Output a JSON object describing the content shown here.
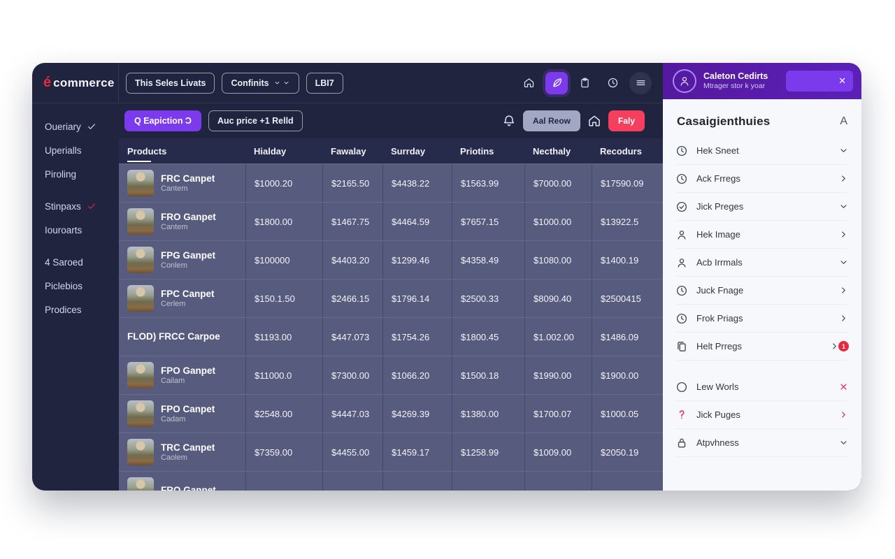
{
  "brand": {
    "mark": "é",
    "name": "commerce"
  },
  "colors": {
    "accent_purple": "#7c3aed",
    "accent_red": "#f43f5e",
    "brand_red": "#e8283f",
    "window_bg": "#20243e",
    "row_bg": "#575b7d",
    "panel_header_purple": "#5b21b6"
  },
  "header": {
    "btn_sales": "This Seles Livats",
    "btn_configs": "Confinits",
    "btn_code": "LBI7",
    "icons": [
      "home",
      "feather",
      "clipboard",
      "clock",
      "menu"
    ],
    "active_icon": "feather"
  },
  "toolbar": {
    "btn_expect": "Q Eapiction Ɔ",
    "btn_price": "Auc price +1 Relld",
    "bell_icon": "bell",
    "btn_review": "Aal Reow",
    "home_icon": "home",
    "btn_faly": "Faly"
  },
  "sidebar": {
    "items": [
      {
        "label": "Oueriary",
        "check": "white",
        "gap": false
      },
      {
        "label": "Uperialls",
        "check": null,
        "gap": false
      },
      {
        "label": "Piroling",
        "check": null,
        "gap": false
      },
      {
        "label": "Stinpaxs",
        "check": "red",
        "gap": true
      },
      {
        "label": "Iouroarts",
        "check": null,
        "gap": false
      },
      {
        "label": "4 Saroed",
        "check": null,
        "gap": true
      },
      {
        "label": "Piclebios",
        "check": null,
        "gap": false
      },
      {
        "label": "Prodices",
        "check": null,
        "gap": false
      }
    ]
  },
  "table": {
    "columns": [
      "Products",
      "Hialday",
      "Fawalay",
      "Surrday",
      "Priotins",
      "Necthaly",
      "Recodurs"
    ],
    "rows": [
      {
        "name": "FRC Canpet",
        "sub": "Cantem",
        "img": true,
        "values": [
          "$1000.20",
          "$2165.50",
          "$4438.22",
          "$1563.99",
          "$7000.00",
          "$17590.09"
        ]
      },
      {
        "name": "FRO Ganpet",
        "sub": "Cantem",
        "img": true,
        "values": [
          "$1800.00",
          "$1467.75",
          "$4464.59",
          "$7657.15",
          "$1000.00",
          "$13922.5"
        ]
      },
      {
        "name": "FPG Ganpet",
        "sub": "Conlem",
        "img": true,
        "values": [
          "$100000",
          "$4403.20",
          "$1299.46",
          "$4358.49",
          "$1080.00",
          "$1400.19"
        ]
      },
      {
        "name": "FPC Canpet",
        "sub": "Cerlem",
        "img": true,
        "values": [
          "$150.1.50",
          "$2466.15",
          "$1796.14",
          "$2500.33",
          "$8090.40",
          "$2500415"
        ]
      },
      {
        "name": "FLOD) FRCC Carpoe",
        "sub": "",
        "img": false,
        "values": [
          "$1193.00",
          "$447.073",
          "$1754.26",
          "$1800.45",
          "$1.002.00",
          "$1486.09"
        ]
      },
      {
        "name": "FPO Ganpet",
        "sub": "Cailam",
        "img": true,
        "values": [
          "$11000.0",
          "$7300.00",
          "$1066.20",
          "$1500.18",
          "$1990.00",
          "$1900.00"
        ]
      },
      {
        "name": "FPO Canpet",
        "sub": "Cadam",
        "img": true,
        "values": [
          "$2548.00",
          "$4447.03",
          "$4269.39",
          "$1380.00",
          "$1700.07",
          "$1000.05"
        ]
      },
      {
        "name": "TRC Canpet",
        "sub": "Caolem",
        "img": true,
        "values": [
          "$7359.00",
          "$4455.00",
          "$1459.17",
          "$1258.99",
          "$1009.00",
          "$2050.19"
        ]
      },
      {
        "name": "FRO Ganpet",
        "sub": "",
        "img": true,
        "values": [
          "",
          "",
          "",
          "",
          "",
          ""
        ]
      }
    ]
  },
  "panel": {
    "user": {
      "name": "Caleton Cedirts",
      "subtitle": "Mtrager stor k yoar",
      "close": "✕"
    },
    "title": "Casaigienthuies",
    "title_action": "A",
    "items": [
      {
        "icon": "clock",
        "label": "Hek Sneet",
        "trail": "chevron-down",
        "red_icon": false,
        "red_trail": false,
        "badge": null,
        "group_gap": false
      },
      {
        "icon": "clock",
        "label": "Ack Frregs",
        "trail": "chevron-right",
        "red_icon": false,
        "red_trail": false,
        "badge": null,
        "group_gap": false
      },
      {
        "icon": "check-circle",
        "label": "Jick Preges",
        "trail": "chevron-down",
        "red_icon": false,
        "red_trail": false,
        "badge": null,
        "group_gap": false
      },
      {
        "icon": "user",
        "label": "Hek Image",
        "trail": "chevron-right",
        "red_icon": false,
        "red_trail": false,
        "badge": null,
        "group_gap": false
      },
      {
        "icon": "user",
        "label": "Acb Irrmals",
        "trail": "chevron-down",
        "red_icon": false,
        "red_trail": false,
        "badge": null,
        "group_gap": false
      },
      {
        "icon": "clock",
        "label": "Juck Fnage",
        "trail": "chevron-right",
        "red_icon": false,
        "red_trail": false,
        "badge": null,
        "group_gap": false
      },
      {
        "icon": "clock",
        "label": "Frok Priags",
        "trail": "chevron-right",
        "red_icon": false,
        "red_trail": false,
        "badge": null,
        "group_gap": false
      },
      {
        "icon": "copy",
        "label": "Helt Prregs",
        "trail": "chevron-right",
        "red_icon": false,
        "red_trail": false,
        "badge": "1",
        "group_gap": false
      },
      {
        "icon": "circle",
        "label": "Lew Worls",
        "trail": "x",
        "red_icon": false,
        "red_trail": true,
        "badge": null,
        "group_gap": true
      },
      {
        "icon": "hook",
        "label": "Jick Puges",
        "trail": "chevron-right",
        "red_icon": true,
        "red_trail": true,
        "badge": null,
        "group_gap": false
      },
      {
        "icon": "lock",
        "label": "Atpvhness",
        "trail": "chevron-down",
        "red_icon": false,
        "red_trail": false,
        "badge": null,
        "group_gap": false
      }
    ]
  }
}
